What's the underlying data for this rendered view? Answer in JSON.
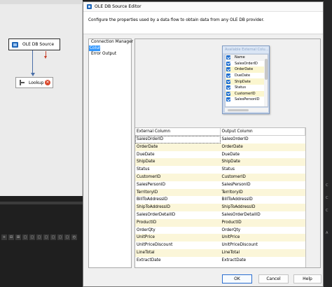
{
  "designer": {
    "source_component": "OLE DB Source",
    "lookup_component": "Lookup",
    "error_glyph": "✕",
    "toolbar_glyphs": [
      "+",
      "⊟",
      "⊞",
      "▢",
      "▢",
      "▢",
      "▢",
      "▢",
      "▢",
      "▢",
      "◴"
    ]
  },
  "side_marks": [
    "C",
    "C",
    "C",
    "A"
  ],
  "dialog": {
    "title": "OLE DB Source Editor",
    "intro": "Configure the properties used by a data flow to obtain data from any OLE DB provider.",
    "nav_items": [
      "Connection Manager",
      "Columns",
      "Error Output"
    ],
    "selected_nav": "Columns",
    "available_columns": {
      "header": "Available External Colu...",
      "items": [
        "Name",
        "SalesOrderID",
        "OrderDate",
        "DueDate",
        "ShipDate",
        "Status",
        "CustomerID",
        "SalesPersonID"
      ]
    },
    "mapping_table": {
      "headers": [
        "External Column",
        "Output Column"
      ],
      "rows": [
        [
          "SalesOrderID",
          "SalesOrderID"
        ],
        [
          "OrderDate",
          "OrderDate"
        ],
        [
          "DueDate",
          "DueDate"
        ],
        [
          "ShipDate",
          "ShipDate"
        ],
        [
          "Status",
          "Status"
        ],
        [
          "CustomerID",
          "CustomerID"
        ],
        [
          "SalesPersonID",
          "SalesPersonID"
        ],
        [
          "TerritoryID",
          "TerritoryID"
        ],
        [
          "BillToAddressID",
          "BillToAddressID"
        ],
        [
          "ShipToAddressID",
          "ShipToAddressID"
        ],
        [
          "SalesOrderDetailID",
          "SalesOrderDetailID"
        ],
        [
          "ProductID",
          "ProductID"
        ],
        [
          "OrderQty",
          "OrderQty"
        ],
        [
          "UnitPrice",
          "UnitPrice"
        ],
        [
          "UnitPriceDiscount",
          "UnitPriceDiscount"
        ],
        [
          "LineTotal",
          "LineTotal"
        ],
        [
          "ExtractDate",
          "ExtractDate"
        ]
      ]
    },
    "buttons": {
      "ok": "OK",
      "cancel": "Cancel",
      "help": "Help"
    }
  },
  "colors": {
    "selection": "#3297fd",
    "row_highlight": "#fbf6d9",
    "checkbox": "#1f6fd0",
    "accent_border": "#2a6ed1"
  },
  "icons": {
    "title": "ole-db-source-icon",
    "source": "database-source-icon",
    "lookup": "lookup-icon",
    "error": "error-icon"
  }
}
